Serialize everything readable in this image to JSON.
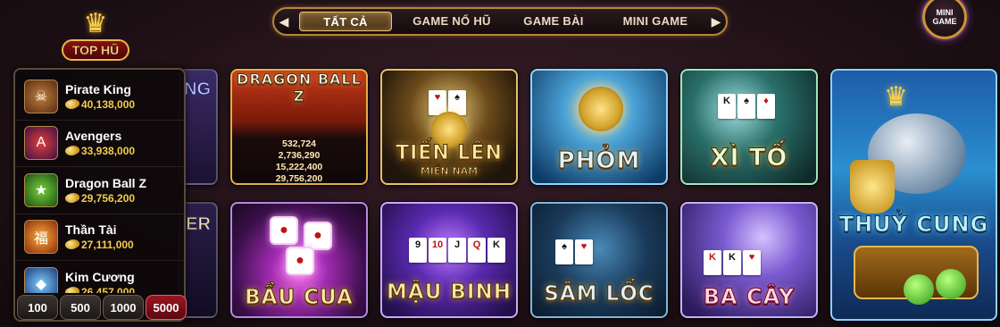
{
  "nav": {
    "prev_icon": "chevron-left-icon",
    "next_icon": "chevron-right-icon",
    "tabs": [
      "TẤT CẢ",
      "GAME NỔ HŨ",
      "GAME BÀI",
      "MINI GAME"
    ],
    "active_tab": "TẤT CẢ"
  },
  "mini_game": {
    "label": "MINI\nGAME"
  },
  "top_hu": {
    "title": "TOP HŨ",
    "jackpots": [
      {
        "name": "Pirate King",
        "value": "40,138,000"
      },
      {
        "name": "Avengers",
        "value": "33,938,000"
      },
      {
        "name": "Dragon Ball Z",
        "value": "29,756,200"
      },
      {
        "name": "Thần Tài",
        "value": "27,111,000"
      },
      {
        "name": "Kim Cương",
        "value": "26,457,000"
      }
    ],
    "bets": [
      "100",
      "500",
      "1000",
      "5000"
    ],
    "active_bet": "5000"
  },
  "games": {
    "partial1": "NG",
    "partial2": "ER",
    "dragon_ball": {
      "logo": "DRAGON BALL Z",
      "jackpots": [
        "532,724",
        "2,736,290",
        "15,222,400",
        "29,756,200"
      ]
    },
    "tien_len": {
      "title": "TIẾN LÊN",
      "subtitle": "MIỀN NAM"
    },
    "phom": {
      "title": "PHỎM"
    },
    "xi_to": {
      "title": "XÌ TỐ"
    },
    "thuy_cung": {
      "title": "THUỶ CUNG"
    },
    "bau_cua": {
      "title": "BẦU CUA"
    },
    "mau_binh": {
      "title": "MẬU BINH"
    },
    "sam_loc": {
      "title": "SÂM LỐC"
    },
    "ba_cay": {
      "title": "BA CÂY"
    }
  }
}
